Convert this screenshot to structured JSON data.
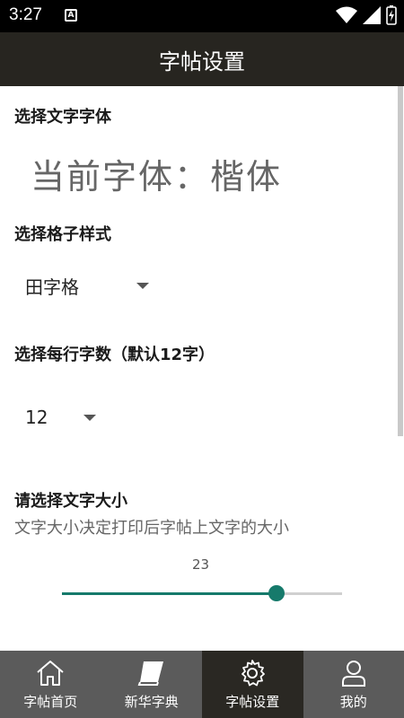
{
  "status": {
    "time": "3:27"
  },
  "app_bar": {
    "title": "字帖设置"
  },
  "sections": {
    "font": {
      "title": "选择文字字体",
      "current": "当前字体：楷体"
    },
    "grid": {
      "title": "选择格子样式",
      "selected": "田字格"
    },
    "per_row": {
      "title": "选择每行字数（默认12字）",
      "selected": "12"
    },
    "size": {
      "title": "请选择文字大小",
      "description": "文字大小决定打印后字帖上文字的大小",
      "value": "23",
      "fraction": 0.765
    }
  },
  "nav": [
    {
      "label": "字帖首页",
      "icon": "home-icon",
      "active": false
    },
    {
      "label": "新华字典",
      "icon": "book-icon",
      "active": false
    },
    {
      "label": "字帖设置",
      "icon": "gear-icon",
      "active": true
    },
    {
      "label": "我的",
      "icon": "person-icon",
      "active": false
    }
  ],
  "colors": {
    "accent": "#167a6b",
    "app_bar": "#272520",
    "nav_bg": "#5b5b5b",
    "nav_active": "#2a2823"
  }
}
